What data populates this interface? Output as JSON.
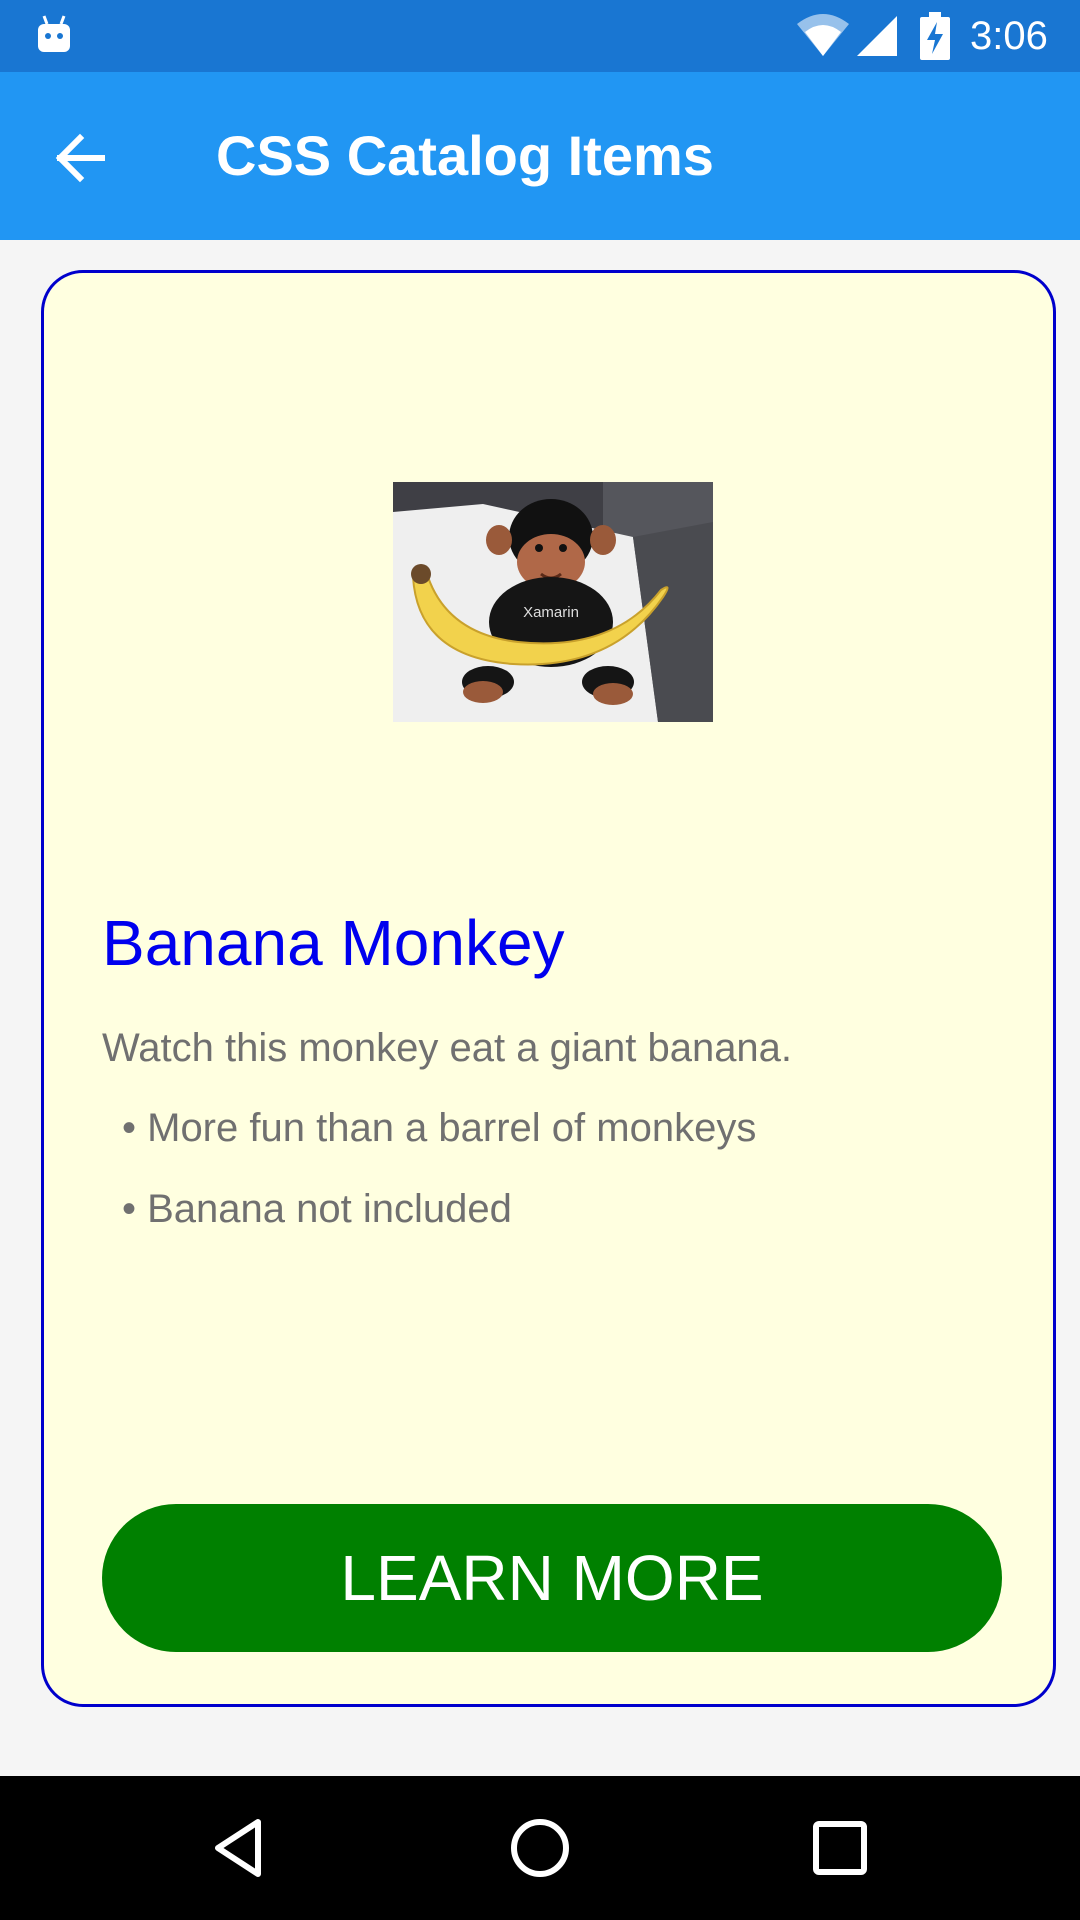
{
  "status_bar": {
    "time": "3:06",
    "icons": [
      "android-icon",
      "wifi-icon",
      "signal-icon",
      "battery-charging-icon"
    ]
  },
  "app_bar": {
    "back_icon": "arrow-left-icon",
    "title": "CSS Catalog Items"
  },
  "card": {
    "image_alt": "Plush monkey wearing a Xamarin shirt holding a banana",
    "image_shirt_text": "Xamarin",
    "title": "Banana Monkey",
    "description": "Watch this monkey eat a giant banana.",
    "bullets": [
      "• More fun than a barrel of monkeys",
      "• Banana not included"
    ],
    "button_label": "LEARN MORE"
  },
  "nav_bar": {
    "icons": [
      "back-triangle-icon",
      "home-circle-icon",
      "recents-square-icon"
    ]
  },
  "colors": {
    "status_bar": "#1976d2",
    "app_bar": "#2196f3",
    "card_background": "#ffffe0",
    "card_border": "#0000cc",
    "title": "#0000ee",
    "body_text": "#707070",
    "button": "#008000"
  }
}
